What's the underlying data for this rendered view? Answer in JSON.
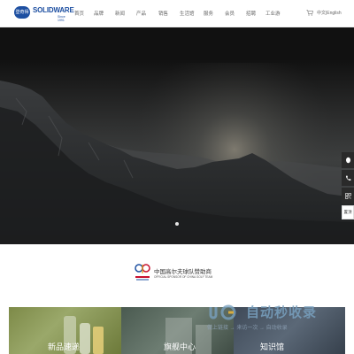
{
  "header": {
    "logo": {
      "badge": "登奇得",
      "word": "SOLIDWARE",
      "since": "Since 1991"
    },
    "nav": [
      {
        "label": "首页"
      },
      {
        "label": "品牌"
      },
      {
        "label": "新闻"
      },
      {
        "label": "产品"
      },
      {
        "label": "销售"
      },
      {
        "label": "生活馆"
      },
      {
        "label": "服务"
      },
      {
        "label": "会员"
      },
      {
        "label": "招聘"
      },
      {
        "label": "工业游"
      }
    ],
    "lang_label": "中文|English"
  },
  "hero": {
    "slide_count": 1,
    "active_slide": 1
  },
  "sidebar": {
    "top_label": "置顶"
  },
  "sponsor": {
    "cn": "中国高尔夫球队赞助商",
    "en": "OFFICIAL SPONSOR OF CHINA GOLF TEAM"
  },
  "tiles": [
    {
      "label": "新品速递"
    },
    {
      "label": "旗舰中心"
    },
    {
      "label": "知识馆"
    }
  ],
  "watermark": {
    "title": "自动秒收录",
    "sub": "做上链接 → 来访一次 → 自动收录"
  },
  "colors": {
    "brand": "#1d4fa1",
    "header_text": "#666666"
  }
}
